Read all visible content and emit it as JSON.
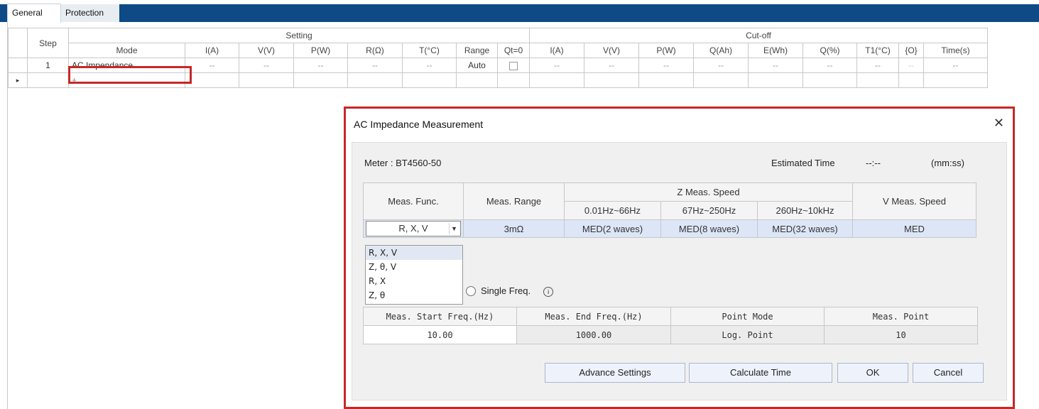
{
  "tabs": [
    {
      "label": "General",
      "active": true
    },
    {
      "label": "Protection",
      "active": false
    }
  ],
  "grid": {
    "header": {
      "step": "Step",
      "setting_group": "Setting",
      "cutoff_group": "Cut-off",
      "setting_cols": [
        "Mode",
        "I(A)",
        "V(V)",
        "P(W)",
        "R(Ω)",
        "T(°C)",
        "Range",
        "Qt=0"
      ],
      "cutoff_cols": [
        "I(A)",
        "V(V)",
        "P(W)",
        "Q(Ah)",
        "E(Wh)",
        "Q(%)",
        "T1(°C)",
        "{O}",
        "Time(s)"
      ]
    },
    "rows": [
      {
        "step": "1",
        "mode": "AC Impendance",
        "setting": [
          "--",
          "--",
          "--",
          "--",
          "--"
        ],
        "range": "Auto",
        "qt0_checked": false,
        "cutoff": [
          "--",
          "--",
          "--",
          "--",
          "--",
          "--",
          "--",
          "--",
          "--"
        ]
      }
    ],
    "new_row": {
      "marker": "▸",
      "add": "+"
    }
  },
  "dialog": {
    "title": "AC Impedance Measurement",
    "meter": "Meter : BT4560-50",
    "estimated_time_label": "Estimated Time",
    "estimated_time_value": "--:--",
    "estimated_time_unit": "(mm:ss)",
    "meas_table": {
      "func_header": "Meas. Func.",
      "range_header": "Meas. Range",
      "z_speed_header": "Z Meas. Speed",
      "v_speed_header": "V Meas. Speed",
      "z_bands": [
        "0.01Hz~66Hz",
        "67Hz~250Hz",
        "260Hz~10kHz"
      ],
      "row": {
        "func": "R, X, V",
        "range": "3mΩ",
        "z_speeds": [
          "MED(2 waves)",
          "MED(8 waves)",
          "MED(32 waves)"
        ],
        "v_speed": "MED"
      }
    },
    "func_options": [
      "R, X, V",
      "Z, θ, V",
      "R, X",
      "Z, θ"
    ],
    "single_freq_label": "Single Freq.",
    "info_glyph": "i",
    "freq_table": {
      "headers": [
        "Meas. Start Freq.(Hz)",
        "Meas. End Freq.(Hz)",
        "Point Mode",
        "Meas. Point"
      ],
      "values": [
        "10.00",
        "1000.00",
        "Log. Point",
        "10"
      ]
    },
    "buttons": {
      "advance": "Advance Settings",
      "calculate": "Calculate Time",
      "ok": "OK",
      "cancel": "Cancel"
    },
    "close_glyph": "✕",
    "accent_color": "#c62828"
  }
}
